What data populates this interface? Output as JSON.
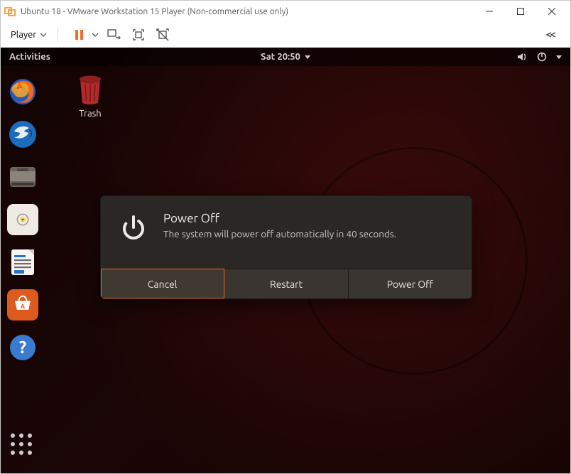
{
  "vmware": {
    "window_title": "Ubuntu 18 - VMware Workstation 15 Player (Non-commercial use only)",
    "player_menu_label": "Player"
  },
  "ubuntu": {
    "activities_label": "Activities",
    "clock": "Sat 20:50",
    "trash_label": "Trash",
    "dock_items": [
      "firefox",
      "thunderbird",
      "files",
      "rhythmbox",
      "libreoffice-writer",
      "ubuntu-software",
      "help"
    ]
  },
  "dialog": {
    "title": "Power Off",
    "message": "The system will power off automatically in 40 seconds.",
    "cancel_label": "Cancel",
    "restart_label": "Restart",
    "poweroff_label": "Power Off"
  }
}
